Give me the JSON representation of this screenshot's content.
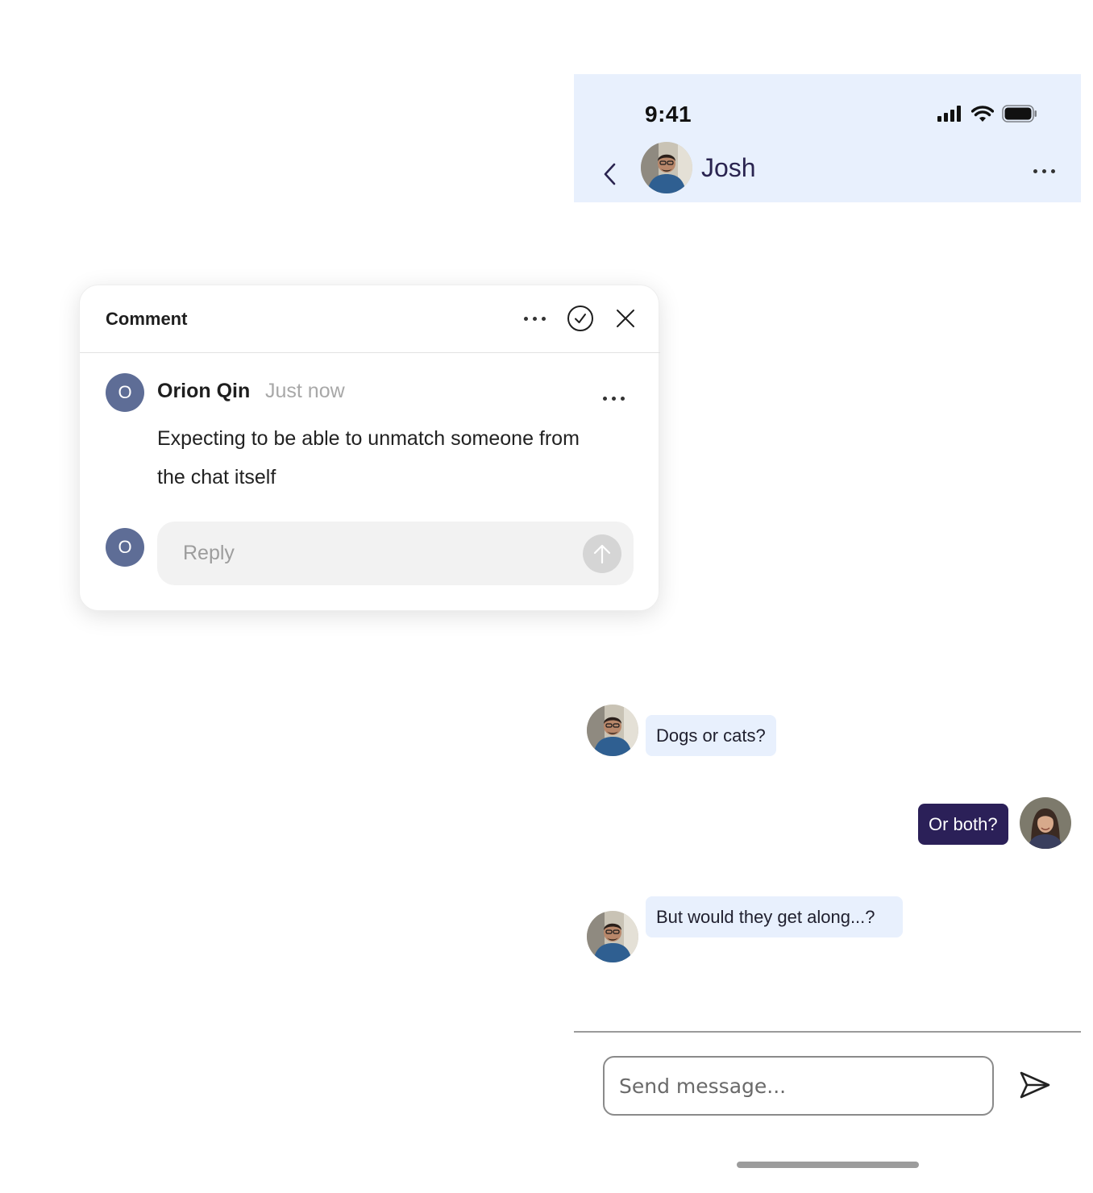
{
  "phone": {
    "status": {
      "time": "9:41"
    },
    "header": {
      "contact_name": "Josh"
    },
    "messages": [
      {
        "direction": "incoming",
        "text": "Dogs or cats?"
      },
      {
        "direction": "outgoing",
        "text": "Or both?"
      },
      {
        "direction": "incoming",
        "text": "But would they get along...?"
      }
    ],
    "composer": {
      "placeholder": "Send message..."
    }
  },
  "comment_card": {
    "title": "Comment",
    "author_initial": "O",
    "author_name": "Orion Qin",
    "timestamp": "Just now",
    "body": "Expecting to be able to unmatch someone from the chat itself",
    "reply_avatar_initial": "O",
    "reply_placeholder": "Reply"
  },
  "colors": {
    "header_bg": "#e8f0fd",
    "incoming_bubble": "#e8f0fd",
    "outgoing_bubble": "#2b2058",
    "initial_avatar": "#5e6d96"
  },
  "icons": [
    "signal-icon",
    "wifi-icon",
    "battery-icon",
    "back-chevron-icon",
    "more-icon",
    "resolve-check-icon",
    "close-icon",
    "arrow-up-icon",
    "send-icon"
  ]
}
